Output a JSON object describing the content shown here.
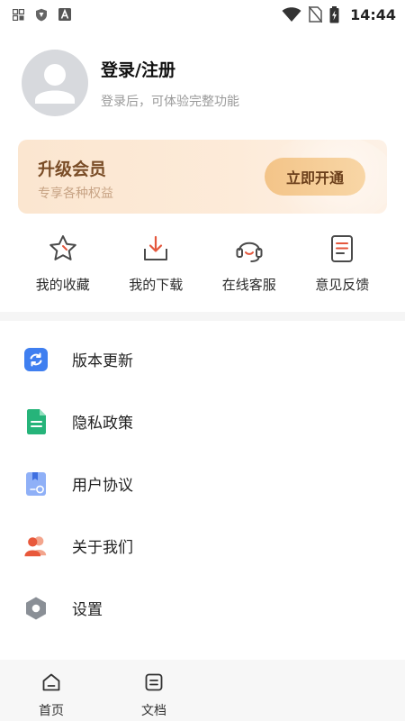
{
  "status_bar": {
    "time": "14:44",
    "icons": [
      "grid-icon",
      "shield-icon",
      "font-a-icon",
      "wifi-icon",
      "no-sim-icon",
      "battery-charging-icon"
    ]
  },
  "profile": {
    "title": "登录/注册",
    "subtitle": "登录后，可体验完整功能",
    "avatar_icon": "user-avatar-icon"
  },
  "vip": {
    "title": "升级会员",
    "subtitle": "专享各种权益",
    "button_label": "立即开通"
  },
  "quick_actions": [
    {
      "label": "我的收藏",
      "icon": "star-icon"
    },
    {
      "label": "我的下载",
      "icon": "download-icon"
    },
    {
      "label": "在线客服",
      "icon": "headset-icon"
    },
    {
      "label": "意见反馈",
      "icon": "feedback-icon"
    }
  ],
  "menu": [
    {
      "label": "版本更新",
      "icon": "refresh-icon"
    },
    {
      "label": "隐私政策",
      "icon": "document-icon"
    },
    {
      "label": "用户协议",
      "icon": "agreement-icon"
    },
    {
      "label": "关于我们",
      "icon": "users-icon"
    },
    {
      "label": "设置",
      "icon": "settings-hexagon-icon"
    }
  ],
  "bottom_nav": [
    {
      "label": "首页",
      "icon": "home-icon"
    },
    {
      "label": "文档",
      "icon": "docs-icon"
    }
  ],
  "colors": {
    "accent_red": "#e4573d",
    "vip_text": "#7a4d27",
    "vip_button": "#f3c488"
  }
}
